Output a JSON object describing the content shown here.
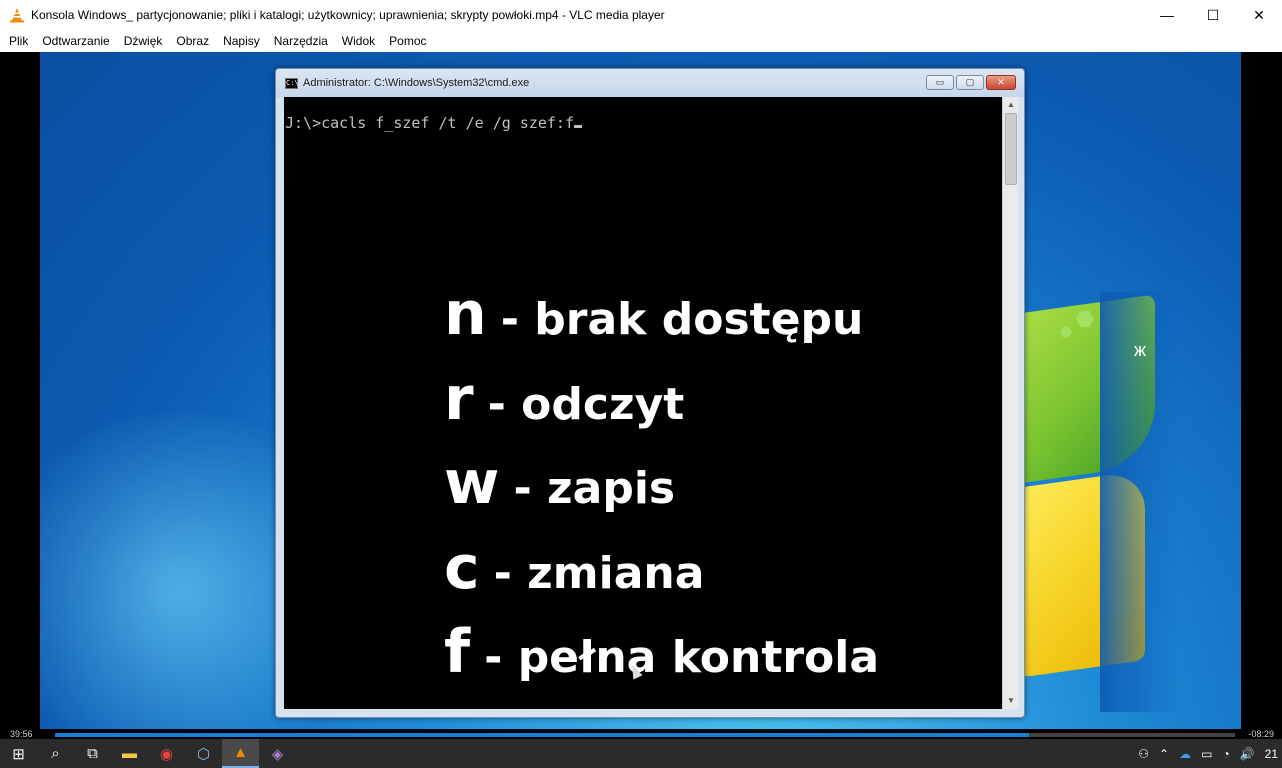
{
  "window": {
    "title": "Konsola Windows_ partycjonowanie; pliki i katalogi; użytkownicy; uprawnienia; skrypty powłoki.mp4 - VLC media player",
    "controls": {
      "minimize": "—",
      "maximize": "☐",
      "close": "✕"
    }
  },
  "menu": {
    "items": [
      "Plik",
      "Odtwarzanie",
      "Dźwięk",
      "Obraz",
      "Napisy",
      "Narzędzia",
      "Widok",
      "Pomoc"
    ]
  },
  "video": {
    "cmd_window": {
      "title": "Administrator: C:\\Windows\\System32\\cmd.exe",
      "icon_label": "C:\\",
      "buttons": {
        "minimize": "▭",
        "maximize": "▢",
        "close": "✕"
      },
      "command_line": "J:\\>cacls f_szef /t /e /g szef:f"
    },
    "legend": [
      {
        "key": "n",
        "desc": "- brak dostępu"
      },
      {
        "key": "r",
        "desc": "- odczyt"
      },
      {
        "key": "w",
        "desc": "- zapis"
      },
      {
        "key": "c",
        "desc": "- zmiana"
      },
      {
        "key": "f",
        "desc": "- pełna kontrola"
      }
    ]
  },
  "playback": {
    "elapsed": "39:56",
    "remaining": "-08:29",
    "progress_fraction": 0.825
  },
  "taskbar": {
    "items": [
      {
        "icon": "windows-start-icon",
        "glyph": "⊞"
      },
      {
        "icon": "search-icon",
        "glyph": "⌕"
      },
      {
        "icon": "task-view-icon",
        "glyph": "⧉"
      },
      {
        "icon": "file-explorer-icon",
        "glyph": "▬"
      },
      {
        "icon": "chrome-icon",
        "glyph": "◉"
      },
      {
        "icon": "virtualbox-icon",
        "glyph": "⬡"
      },
      {
        "icon": "vlc-icon",
        "glyph": "▲"
      },
      {
        "icon": "app-icon",
        "glyph": "◈"
      }
    ],
    "tray": {
      "people": "⚇",
      "chevron": "⌃",
      "onedrive": "☁",
      "battery": "▭",
      "wifi": "◔",
      "volume": "🔊",
      "clock": "21"
    }
  },
  "colors": {
    "accent": "#1a7fd4",
    "vlc_orange": "#f28b00",
    "taskbar": "#2b2b2b"
  }
}
